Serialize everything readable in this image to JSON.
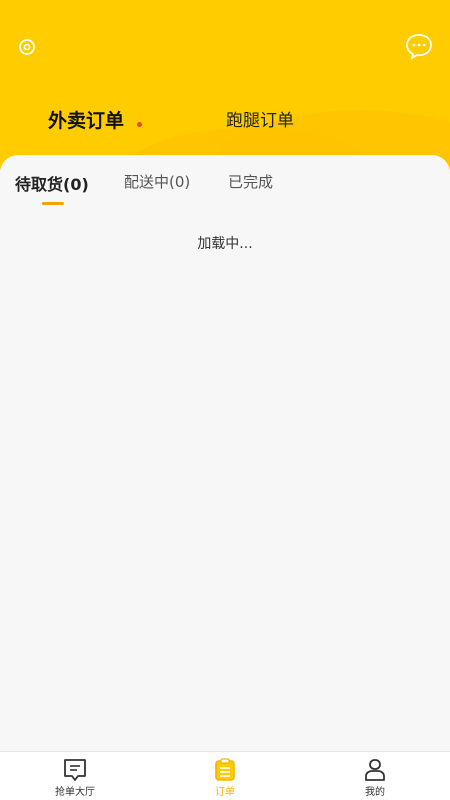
{
  "header": {
    "tabs": [
      {
        "label": "外卖订单",
        "active": true,
        "has_dot": true
      },
      {
        "label": "跑腿订单",
        "active": false
      }
    ],
    "icons": {
      "left": "location-icon",
      "right": "message-icon"
    }
  },
  "sub_tabs": [
    {
      "label": "待取货(0)",
      "active": true
    },
    {
      "label": "配送中(0)",
      "active": false
    },
    {
      "label": "已完成",
      "active": false
    }
  ],
  "status": {
    "loading_text": "加载中..."
  },
  "tabbar": [
    {
      "label": "抢单大厅",
      "icon": "order-hall-icon",
      "active": false
    },
    {
      "label": "订单",
      "icon": "orders-icon",
      "active": true
    },
    {
      "label": "我的",
      "icon": "profile-icon",
      "active": false
    }
  ],
  "colors": {
    "accent": "#ffcc00",
    "active_tab_text": "#ffb400",
    "dot": "#e8442e",
    "underline": "#f2a300"
  }
}
